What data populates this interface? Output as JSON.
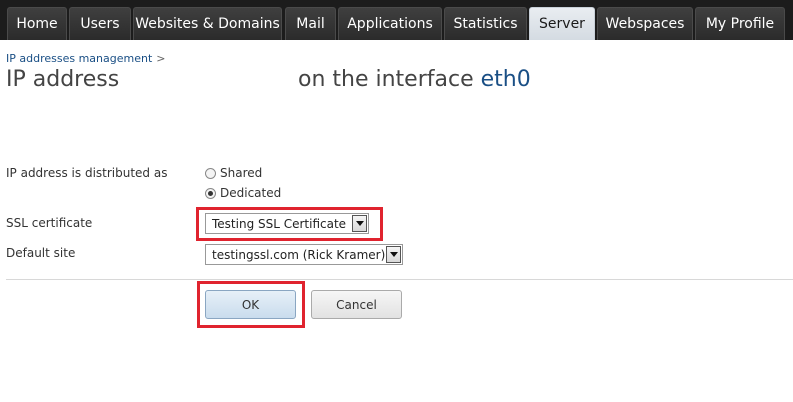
{
  "tabs": [
    {
      "label": "Home",
      "active": false
    },
    {
      "label": "Users",
      "active": false
    },
    {
      "label": "Websites & Domains",
      "active": false
    },
    {
      "label": "Mail",
      "active": false
    },
    {
      "label": "Applications",
      "active": false
    },
    {
      "label": "Statistics",
      "active": false
    },
    {
      "label": "Server",
      "active": true
    },
    {
      "label": "Webspaces",
      "active": false
    },
    {
      "label": "My Profile",
      "active": false
    }
  ],
  "breadcrumb": {
    "link": "IP addresses management",
    "separator": ">"
  },
  "title": {
    "main": "IP address",
    "prefix": "on the interface",
    "interface": "eth0"
  },
  "form": {
    "distribution": {
      "label": "IP address is distributed as",
      "options": [
        {
          "label": "Shared",
          "checked": false
        },
        {
          "label": "Dedicated",
          "checked": true
        }
      ]
    },
    "ssl": {
      "label": "SSL certificate",
      "value": "Testing SSL Certificate"
    },
    "default_site": {
      "label": "Default site",
      "value": "testingssl.com (Rick Kramer)"
    }
  },
  "buttons": {
    "ok": "OK",
    "cancel": "Cancel"
  },
  "colors": {
    "highlight": "#e0232e",
    "link": "#1a4f85",
    "tabbar": "#1c1c1c"
  }
}
